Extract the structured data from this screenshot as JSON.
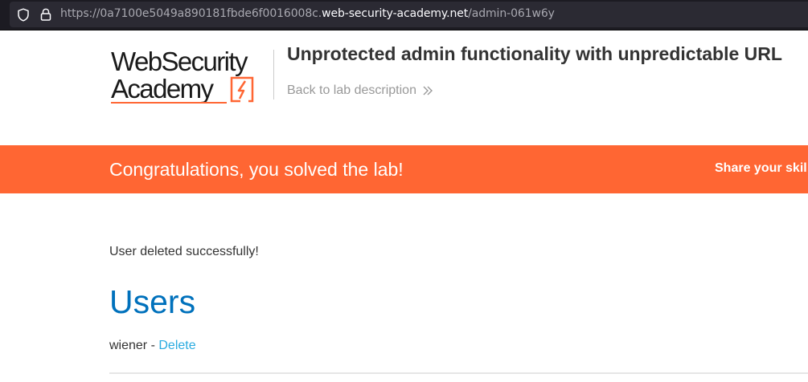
{
  "browser": {
    "url_prefix": "https://0a7100e5049a890181fbde6f0016008c.",
    "url_host": "web-security-academy.net",
    "url_path": "/admin-061w6y",
    "icons": [
      "shield-icon",
      "lock-icon"
    ]
  },
  "header": {
    "logo_line1": "WebSecurity",
    "logo_line2": "Academy",
    "lab_title": "Unprotected admin functionality with unpredictable URL",
    "back_link": "Back to lab description",
    "accent_color": "#ff6633"
  },
  "banner": {
    "message": "Congratulations, you solved the lab!",
    "share": "Share your skil",
    "color": "#ff6633"
  },
  "main": {
    "status_message": "User deleted successfully!",
    "heading": "Users",
    "users": [
      {
        "name": "wiener",
        "separator": " - ",
        "action": "Delete"
      }
    ]
  }
}
